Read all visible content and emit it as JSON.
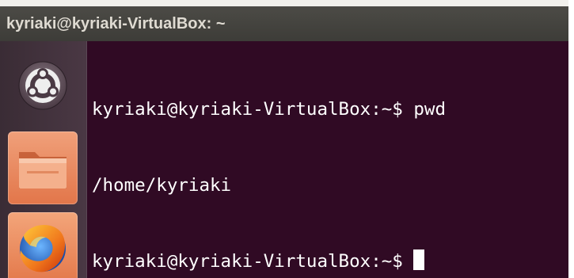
{
  "window": {
    "title": "kyriaki@kyriaki-VirtualBox: ~"
  },
  "launcher": {
    "items": [
      {
        "name": "Dash Home",
        "icon": "ubuntu-logo-icon"
      },
      {
        "name": "Files",
        "icon": "folder-icon"
      },
      {
        "name": "Firefox Web Browser",
        "icon": "firefox-icon"
      }
    ]
  },
  "terminal": {
    "lines": [
      {
        "prompt": "kyriaki@kyriaki-VirtualBox:~$ ",
        "command": "pwd"
      },
      {
        "output": "/home/kyriaki"
      },
      {
        "prompt": "kyriaki@kyriaki-VirtualBox:~$ ",
        "command": ""
      }
    ]
  },
  "colors": {
    "terminal_background": "#300a24",
    "terminal_text": "#ffffff",
    "titlebar": "#3d3c38",
    "launcher_highlight": "#e2764a"
  }
}
